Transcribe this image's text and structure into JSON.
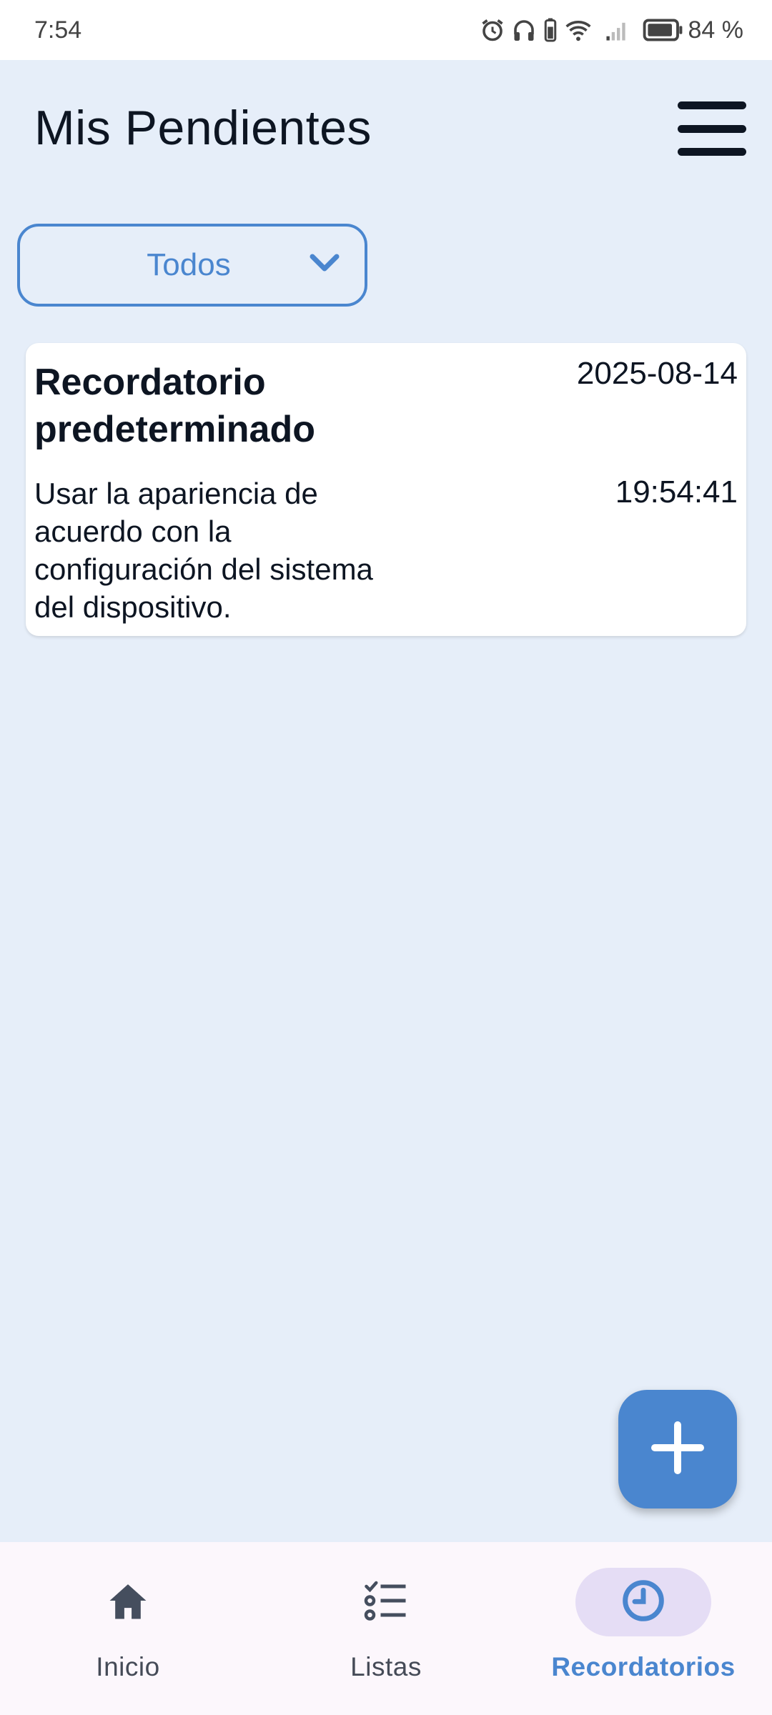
{
  "status_bar": {
    "time": "7:54",
    "battery": "84 %",
    "icons": [
      "alarm-icon",
      "headphones-icon",
      "battery-small-icon",
      "wifi-icon",
      "signal-icon",
      "battery-icon"
    ]
  },
  "header": {
    "title": "Mis Pendientes",
    "menu_icon": "hamburger-menu-icon"
  },
  "filter": {
    "selected": "Todos",
    "icon": "chevron-down-icon"
  },
  "reminders": [
    {
      "title": "Recordatorio predeterminado",
      "description": "Usar la apariencia de acuerdo con la configuración del sistema del dispositivo.",
      "date": "2025-08-14",
      "time": "19:54:41"
    }
  ],
  "fab": {
    "icon": "plus-icon"
  },
  "bottom_nav": {
    "items": [
      {
        "label": "Inicio",
        "icon": "home-icon",
        "active": false
      },
      {
        "label": "Listas",
        "icon": "checklist-icon",
        "active": false
      },
      {
        "label": "Recordatorios",
        "icon": "clock-icon",
        "active": true
      }
    ]
  },
  "colors": {
    "background": "#e6eef9",
    "accent": "#4a86cf",
    "nav_background": "#fcf7fc",
    "nav_active_pill": "#e5ddf5",
    "text_dark": "#0d1522"
  }
}
